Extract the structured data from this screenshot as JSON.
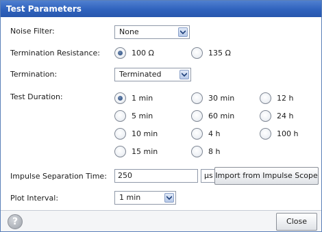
{
  "dialog": {
    "title": "Test Parameters"
  },
  "noise_filter": {
    "label": "Noise Filter:",
    "value": "None"
  },
  "termination_resistance": {
    "label": "Termination Resistance:",
    "options": [
      "100 Ω",
      "135 Ω"
    ],
    "selected": "100 Ω"
  },
  "termination": {
    "label": "Termination:",
    "value": "Terminated"
  },
  "test_duration": {
    "label": "Test Duration:",
    "options": [
      "1 min",
      "5 min",
      "10 min",
      "15 min",
      "30 min",
      "60 min",
      "4 h",
      "8 h",
      "12 h",
      "24 h",
      "100 h"
    ],
    "selected": "1 min"
  },
  "impulse_separation": {
    "label": "Impulse Separation Time:",
    "value": "250",
    "unit": "μs",
    "import_label": "Import from Impulse Scope"
  },
  "plot_interval": {
    "label": "Plot Interval:",
    "value": "1 min"
  },
  "footer": {
    "help_symbol": "?",
    "close_label": "Close"
  },
  "icons": {
    "help": "help-icon",
    "dropdown": "chevron-down-icon"
  }
}
